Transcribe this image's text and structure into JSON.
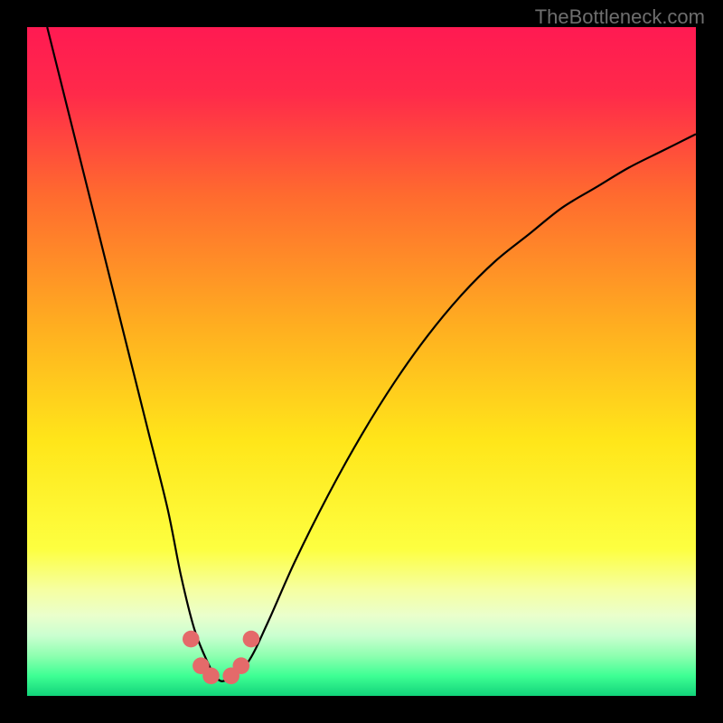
{
  "watermark": "TheBottleneck.com",
  "chart_data": {
    "type": "line",
    "title": "",
    "xlabel": "",
    "ylabel": "",
    "xlim": [
      0,
      100
    ],
    "ylim": [
      0,
      100
    ],
    "grid": false,
    "legend": false,
    "series": [
      {
        "name": "bottleneck-curve",
        "x": [
          3,
          6,
          9,
          12,
          15,
          18,
          21,
          23,
          25,
          27,
          28.5,
          30,
          33,
          36,
          40,
          45,
          50,
          55,
          60,
          65,
          70,
          75,
          80,
          85,
          90,
          95,
          100
        ],
        "y": [
          100,
          88,
          76,
          64,
          52,
          40,
          28,
          18,
          10,
          5,
          2.5,
          2.5,
          5,
          11,
          20,
          30,
          39,
          47,
          54,
          60,
          65,
          69,
          73,
          76,
          79,
          81.5,
          84
        ]
      }
    ],
    "markers": [
      {
        "x": 24.5,
        "y": 8.5,
        "r": 5.5
      },
      {
        "x": 26.0,
        "y": 4.5,
        "r": 5.5
      },
      {
        "x": 27.5,
        "y": 3.0,
        "r": 5.5
      },
      {
        "x": 30.5,
        "y": 3.0,
        "r": 5.5
      },
      {
        "x": 32.0,
        "y": 4.5,
        "r": 5.5
      },
      {
        "x": 33.5,
        "y": 8.5,
        "r": 5.5
      }
    ],
    "gradient_stops": [
      {
        "offset": 0,
        "color": "#ff1a52"
      },
      {
        "offset": 10,
        "color": "#ff2a4a"
      },
      {
        "offset": 25,
        "color": "#ff6a2f"
      },
      {
        "offset": 45,
        "color": "#ffaf20"
      },
      {
        "offset": 62,
        "color": "#ffe61a"
      },
      {
        "offset": 78,
        "color": "#fdff40"
      },
      {
        "offset": 84,
        "color": "#f6ffa0"
      },
      {
        "offset": 88,
        "color": "#eaffcc"
      },
      {
        "offset": 91,
        "color": "#caffd0"
      },
      {
        "offset": 94,
        "color": "#8effb0"
      },
      {
        "offset": 97,
        "color": "#3eff94"
      },
      {
        "offset": 100,
        "color": "#12d47a"
      }
    ],
    "marker_color": "#e46a6a"
  }
}
